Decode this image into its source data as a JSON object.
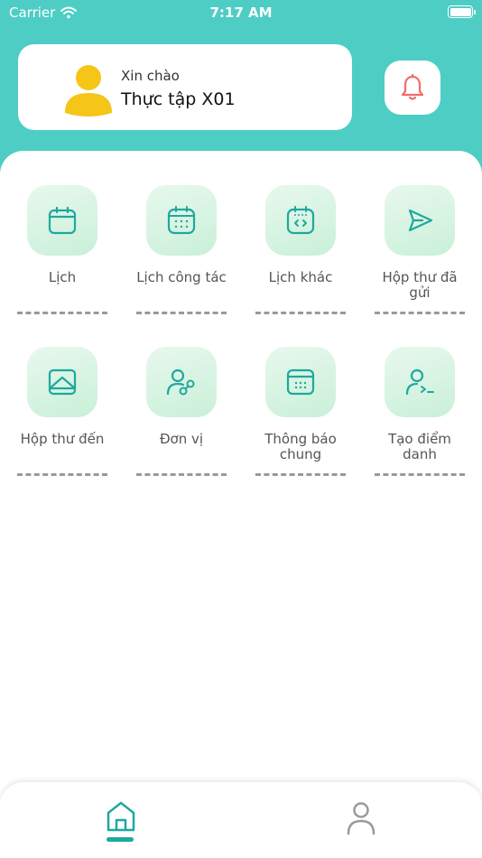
{
  "status_bar": {
    "carrier": "Carrier",
    "time": "7:17 AM"
  },
  "header": {
    "greeting": "Xin chào",
    "user_name": "Thực tập X01"
  },
  "menu": [
    {
      "label": "Lịch",
      "icon": "calendar-icon"
    },
    {
      "label": "Lịch công tác",
      "icon": "work-calendar-icon"
    },
    {
      "label": "Lịch khác",
      "icon": "other-calendar-icon"
    },
    {
      "label": "Hộp thư đã gửi",
      "icon": "send-icon"
    },
    {
      "label": "Hộp thư đến",
      "icon": "inbox-icon"
    },
    {
      "label": "Đơn vị",
      "icon": "unit-icon"
    },
    {
      "label": "Thông báo chung",
      "icon": "announcement-icon"
    },
    {
      "label": "Tạo điểm danh",
      "icon": "attendance-icon"
    }
  ],
  "bottom_nav": [
    {
      "name": "home",
      "icon": "home-icon",
      "active": true
    },
    {
      "name": "profile",
      "icon": "user-icon",
      "active": false
    }
  ],
  "colors": {
    "header_bg": "#4ecdc4",
    "icon_stroke": "#1fa89e",
    "tile_bg": "#d6f4e1",
    "bell": "#f26b6b",
    "avatar": "#f5c518"
  }
}
